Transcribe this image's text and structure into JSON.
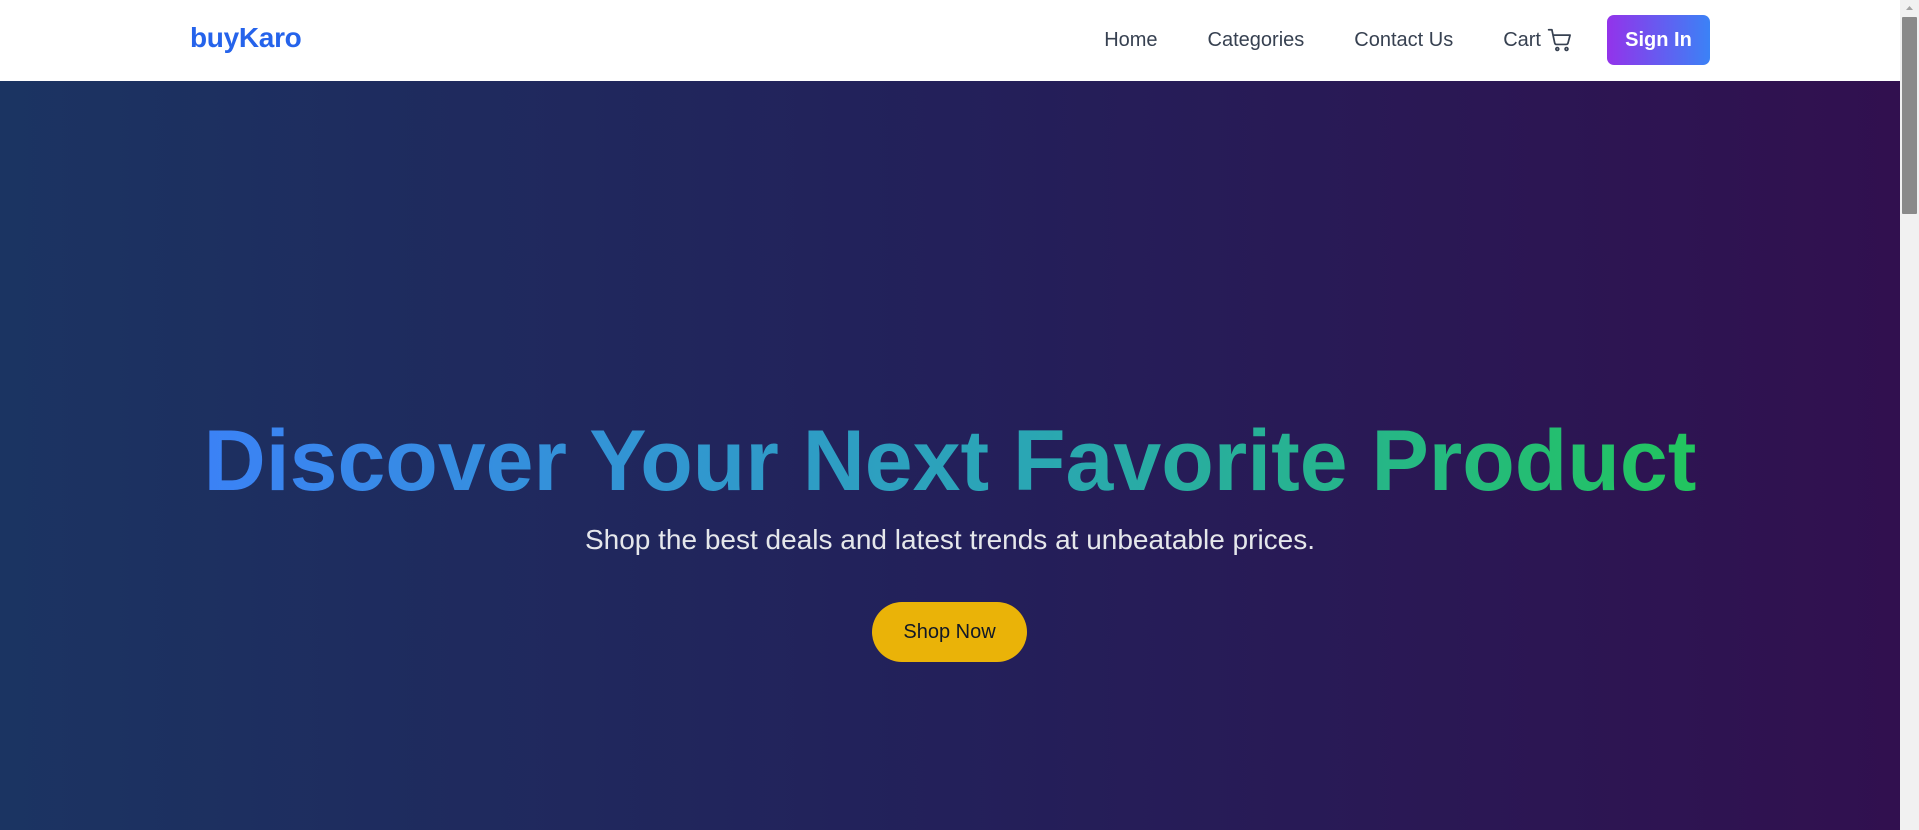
{
  "navbar": {
    "brand": "buyKaro",
    "links": [
      {
        "label": "Home"
      },
      {
        "label": "Categories"
      },
      {
        "label": "Contact Us"
      }
    ],
    "cart": {
      "label": "Cart",
      "icon": "shopping-cart-icon"
    },
    "signin_label": "Sign In"
  },
  "hero": {
    "title": "Discover Your Next Favorite Product",
    "subtitle": "Shop the best deals and latest trends at unbeatable prices.",
    "cta_label": "Shop Now"
  },
  "colors": {
    "brand": "#2563eb",
    "signin_gradient": [
      "#9333ea",
      "#3b82f6"
    ],
    "hero_background": [
      "#1b3462",
      "#23205a",
      "#31104f"
    ],
    "title_gradient": [
      "#3b82f6",
      "#22c55e"
    ],
    "cta": "#eab308"
  }
}
